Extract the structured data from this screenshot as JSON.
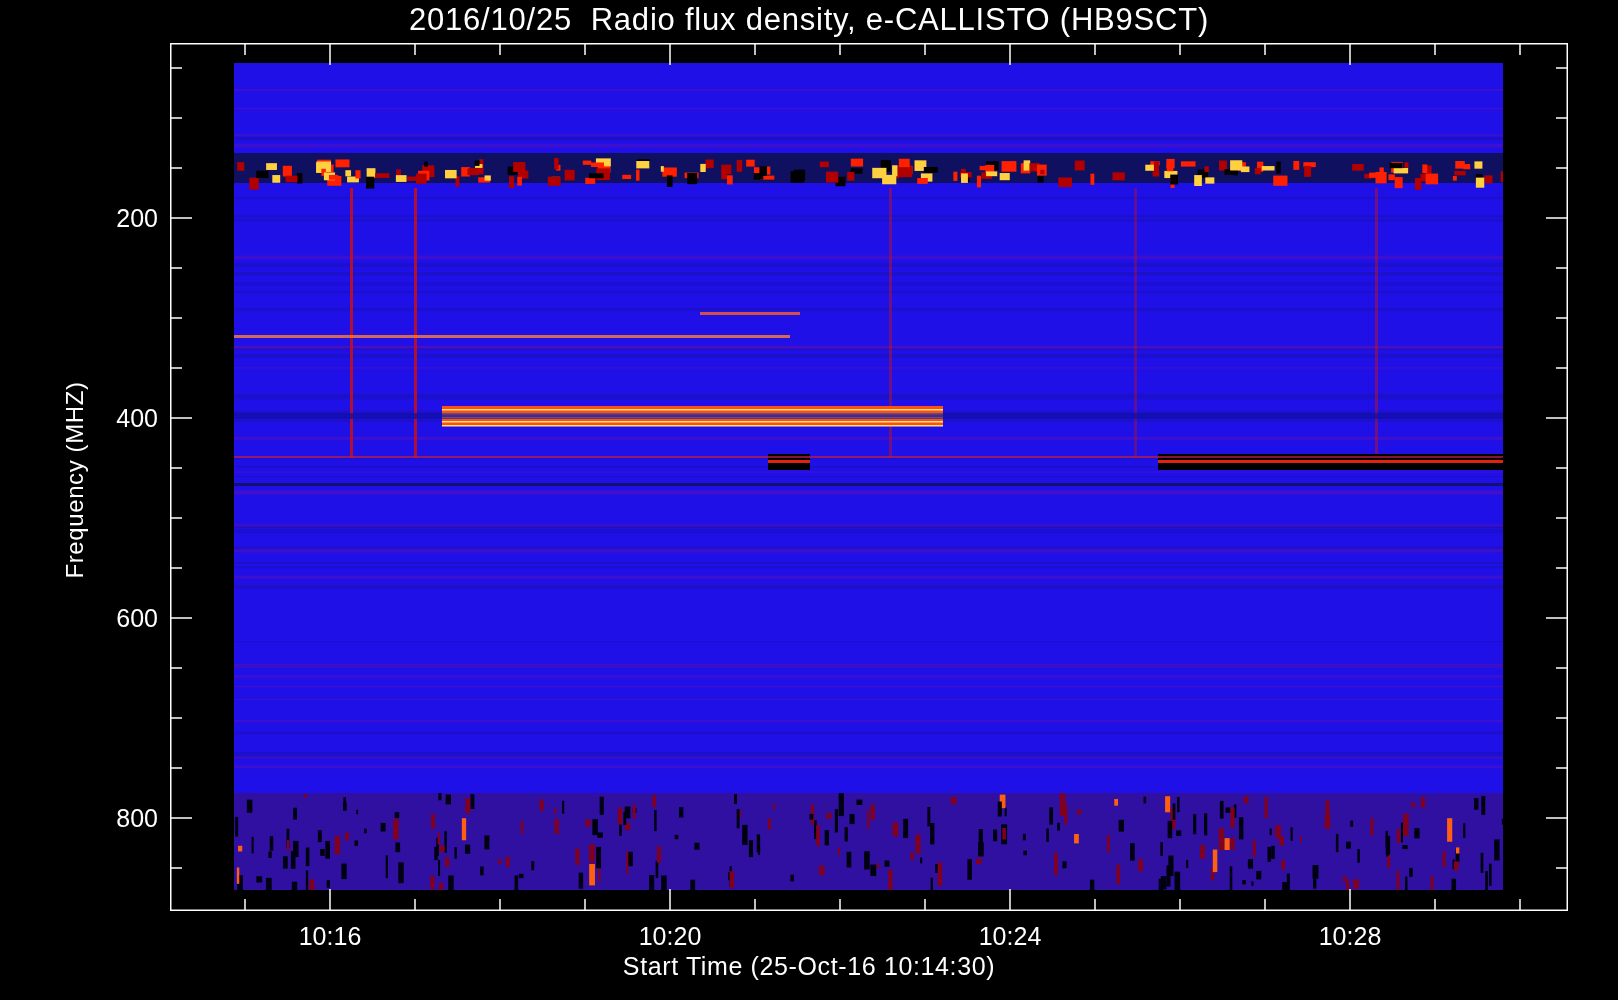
{
  "title": "2016/10/25  Radio flux density, e-CALLISTO (HB9SCT)",
  "y_axis": {
    "label": "Frequency (MHZ)",
    "ticks": [
      "200",
      "400",
      "600",
      "800"
    ]
  },
  "x_axis": {
    "label": "Start Time (25-Oct-16 10:14:30)",
    "ticks": [
      "10:16",
      "10:20",
      "10:24",
      "10:28"
    ]
  }
}
